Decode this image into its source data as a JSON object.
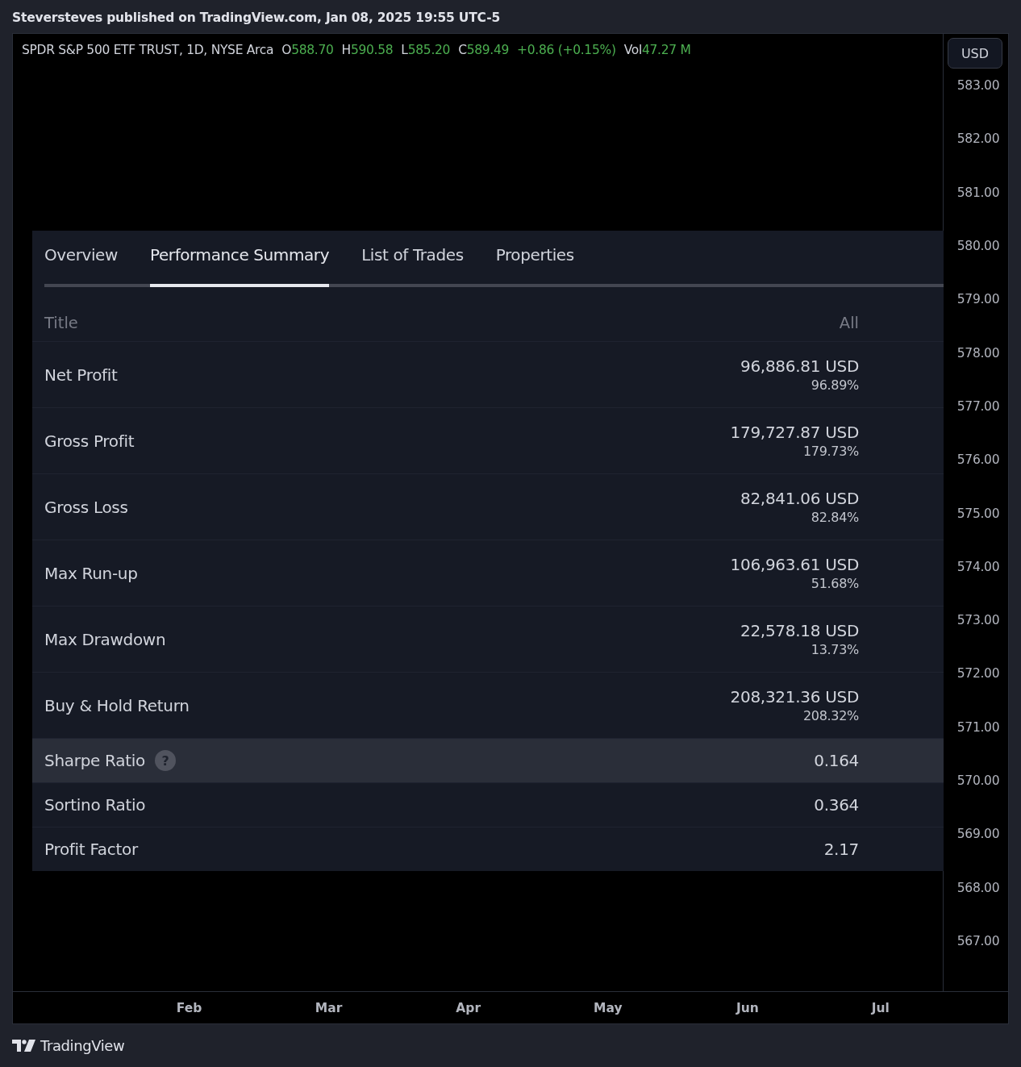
{
  "header": {
    "text": "Steversteves published on TradingView.com, Jan 08, 2025 19:55 UTC-5"
  },
  "legend": {
    "symbol": "SPDR S&P 500 ETF TRUST, 1D, NYSE Arca",
    "fields": [
      {
        "label": "O",
        "value": "588.70"
      },
      {
        "label": "H",
        "value": "590.58"
      },
      {
        "label": "L",
        "value": "585.20"
      },
      {
        "label": "C",
        "value": "589.49"
      },
      {
        "value": "+0.86 (+0.15%)"
      },
      {
        "label": "Vol",
        "value": "47.27 M"
      }
    ]
  },
  "price_axis": {
    "currency": "USD",
    "labels": [
      "583.00",
      "582.00",
      "581.00",
      "580.00",
      "579.00",
      "578.00",
      "577.00",
      "576.00",
      "575.00",
      "574.00",
      "573.00",
      "572.00",
      "571.00",
      "570.00",
      "569.00",
      "568.00",
      "567.00"
    ]
  },
  "time_axis": [
    "Feb",
    "Mar",
    "Apr",
    "May",
    "Jun",
    "Jul"
  ],
  "strategy_panel": {
    "tabs": [
      {
        "label": "Overview",
        "selected": false
      },
      {
        "label": "Performance Summary",
        "selected": true
      },
      {
        "label": "List of Trades",
        "selected": false
      },
      {
        "label": "Properties",
        "selected": false
      }
    ],
    "table": {
      "columns": [
        "Title",
        "All"
      ],
      "rows": [
        {
          "title": "Net Profit",
          "value": "96,886.81 USD",
          "percent": "96.89%",
          "highlighted": false
        },
        {
          "title": "Gross Profit",
          "value": "179,727.87 USD",
          "percent": "179.73%",
          "highlighted": false
        },
        {
          "title": "Gross Loss",
          "value": "82,841.06 USD",
          "percent": "82.84%",
          "highlighted": false
        },
        {
          "title": "Max Run-up",
          "value": "106,963.61 USD",
          "percent": "51.68%",
          "highlighted": false
        },
        {
          "title": "Max Drawdown",
          "value": "22,578.18 USD",
          "percent": "13.73%",
          "highlighted": false
        },
        {
          "title": "Buy & Hold Return",
          "value": "208,321.36 USD",
          "percent": "208.32%",
          "highlighted": false
        },
        {
          "title": "Sharpe Ratio",
          "hint": "?",
          "value": "0.164",
          "highlighted": true
        },
        {
          "title": "Sortino Ratio",
          "value": "0.364",
          "highlighted": false
        },
        {
          "title": "Profit Factor",
          "value": "2.17",
          "highlighted": false
        }
      ]
    }
  },
  "footer": {
    "brand": "TradingView"
  }
}
